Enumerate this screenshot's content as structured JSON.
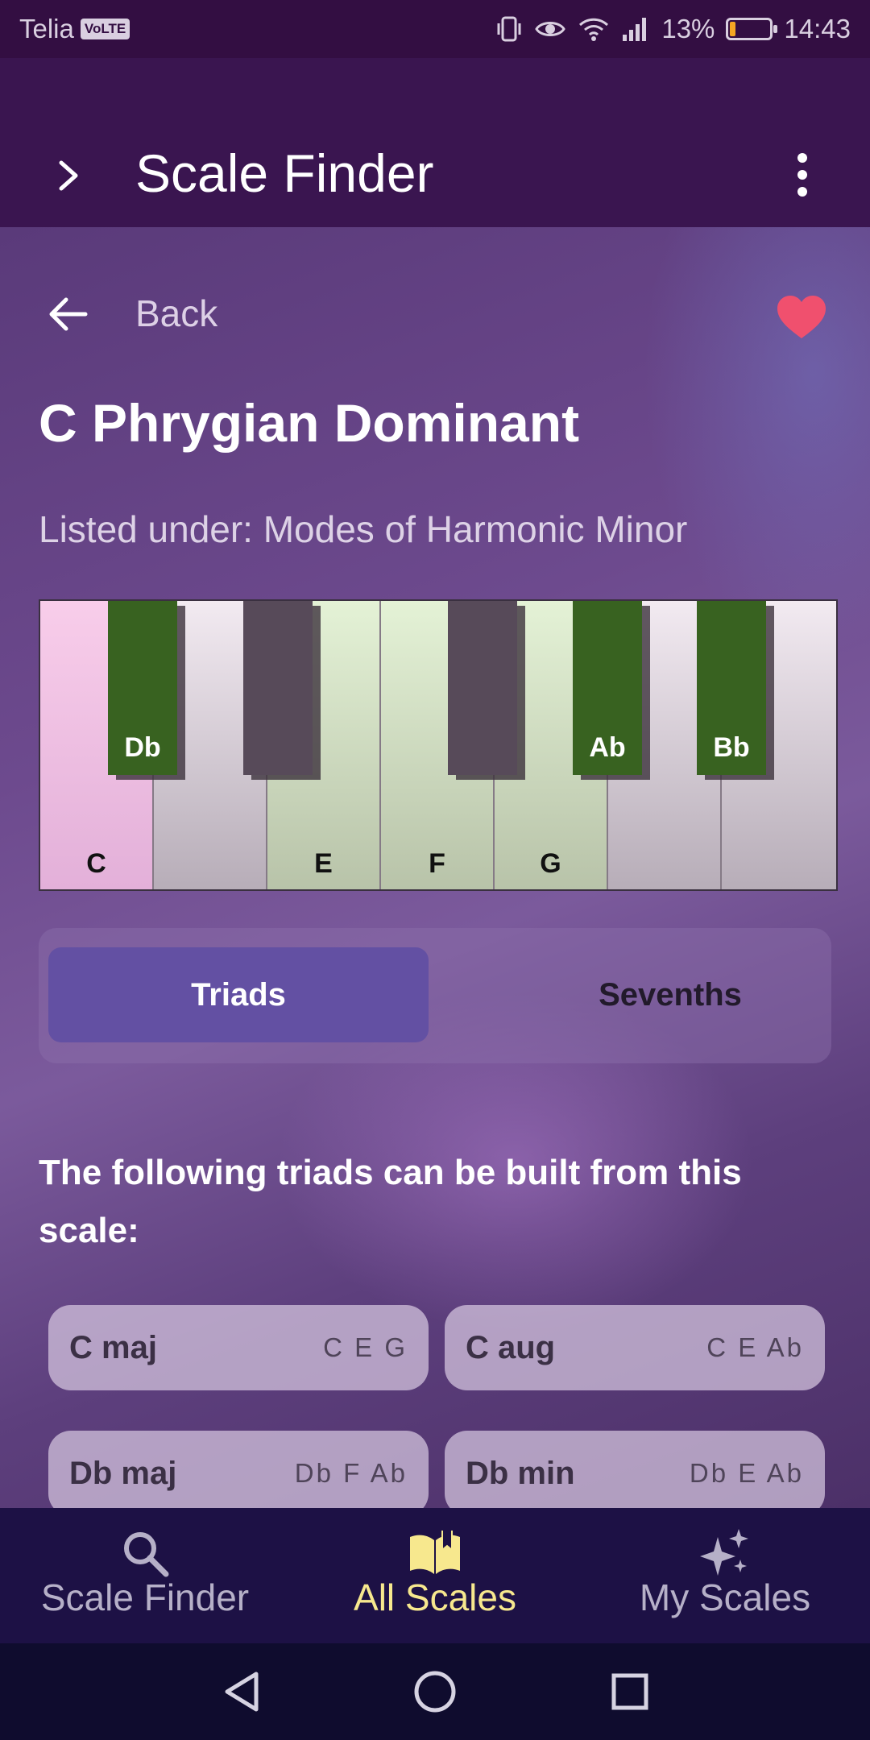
{
  "status_bar": {
    "carrier": "Telia",
    "volte": "VoLTE",
    "battery_percent": "13%",
    "battery_level": 0.13,
    "time": "14:43",
    "icons": [
      "vibrate-icon",
      "eye-icon",
      "wifi-icon",
      "signal-icon",
      "battery-icon"
    ]
  },
  "app_bar": {
    "title": "Scale Finder",
    "nav_icon": "chevron-right-icon",
    "menu_icon": "more-vert-icon"
  },
  "detail": {
    "back_label": "Back",
    "favorite": true,
    "scale_name": "C Phrygian Dominant",
    "listed_under": "Listed under: Modes of Harmonic Minor"
  },
  "keyboard": {
    "white_keys": [
      {
        "label": "C",
        "state": "root"
      },
      {
        "label": "",
        "state": "plain"
      },
      {
        "label": "E",
        "state": "inscale"
      },
      {
        "label": "F",
        "state": "inscale"
      },
      {
        "label": "G",
        "state": "inscale"
      },
      {
        "label": "",
        "state": "plain"
      },
      {
        "label": "",
        "state": "plain"
      }
    ],
    "black_keys": [
      {
        "label": "Db",
        "state": "inscale"
      },
      {
        "label": "",
        "state": "plain"
      },
      {
        "label": "",
        "state": "plain"
      },
      {
        "label": "Ab",
        "state": "inscale"
      },
      {
        "label": "Bb",
        "state": "inscale"
      }
    ],
    "colors": {
      "root": "#f8cdea",
      "inscale_white": "#e4f2d6",
      "inscale_black": "#386220"
    }
  },
  "toggle": {
    "triads_label": "Triads",
    "sevenths_label": "Sevenths",
    "selected": "Triads"
  },
  "prompt": "The following triads can be built from this scale:",
  "chords": [
    {
      "name": "C maj",
      "notes": "C E G"
    },
    {
      "name": "C aug",
      "notes": "C E Ab"
    },
    {
      "name": "Db maj",
      "notes": "Db F Ab"
    },
    {
      "name": "Db min",
      "notes": "Db E Ab"
    }
  ],
  "bottom_nav": {
    "items": [
      {
        "label": "Scale Finder",
        "icon": "search-icon"
      },
      {
        "label": "All Scales",
        "icon": "book-icon",
        "active": true
      },
      {
        "label": "My Scales",
        "icon": "sparkles-icon"
      }
    ],
    "active_color": "#f7e88e"
  },
  "system_nav": [
    "back-triangle-icon",
    "home-circle-icon",
    "recents-square-icon"
  ]
}
